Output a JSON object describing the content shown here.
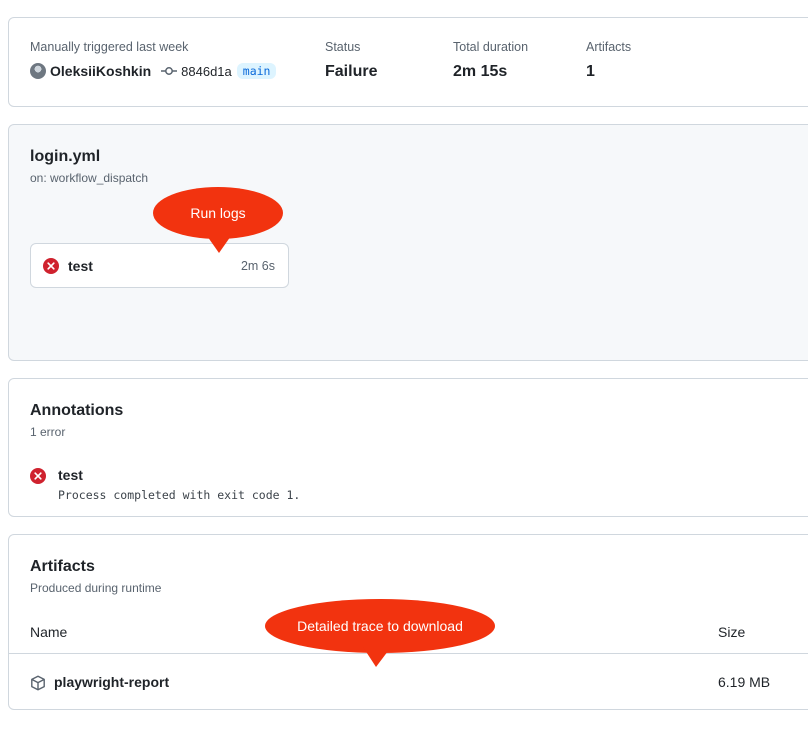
{
  "summary": {
    "trigger_label": "Manually triggered last week",
    "actor": "OleksiiKoshkin",
    "commit_sha": "8846d1a",
    "branch": "main",
    "status_label": "Status",
    "status_value": "Failure",
    "duration_label": "Total duration",
    "duration_value": "2m 15s",
    "artifacts_label": "Artifacts",
    "artifacts_value": "1"
  },
  "workflow": {
    "file": "login.yml",
    "trigger": "on: workflow_dispatch",
    "job": {
      "name": "test",
      "duration": "2m 6s",
      "status": "failure"
    }
  },
  "annotations": {
    "title": "Annotations",
    "count_text": "1 error",
    "items": [
      {
        "job": "test",
        "message": "Process completed with exit code 1.",
        "level": "error"
      }
    ]
  },
  "artifacts": {
    "title": "Artifacts",
    "subtitle": "Produced during runtime",
    "col_name": "Name",
    "col_size": "Size",
    "items": [
      {
        "name": "playwright-report",
        "size": "6.19 MB"
      }
    ]
  },
  "callouts": {
    "run_logs": "Run logs",
    "trace": "Detailed trace to download"
  },
  "colors": {
    "error_red": "#cf222e",
    "callout_red": "#f2330f",
    "branch_blue": "#0969da",
    "branch_bg": "#ddf4ff",
    "border": "#d0d7de"
  },
  "icons": {
    "commit": "git-commit-icon",
    "error": "x-circle-fill-icon",
    "artifact": "package-icon"
  }
}
